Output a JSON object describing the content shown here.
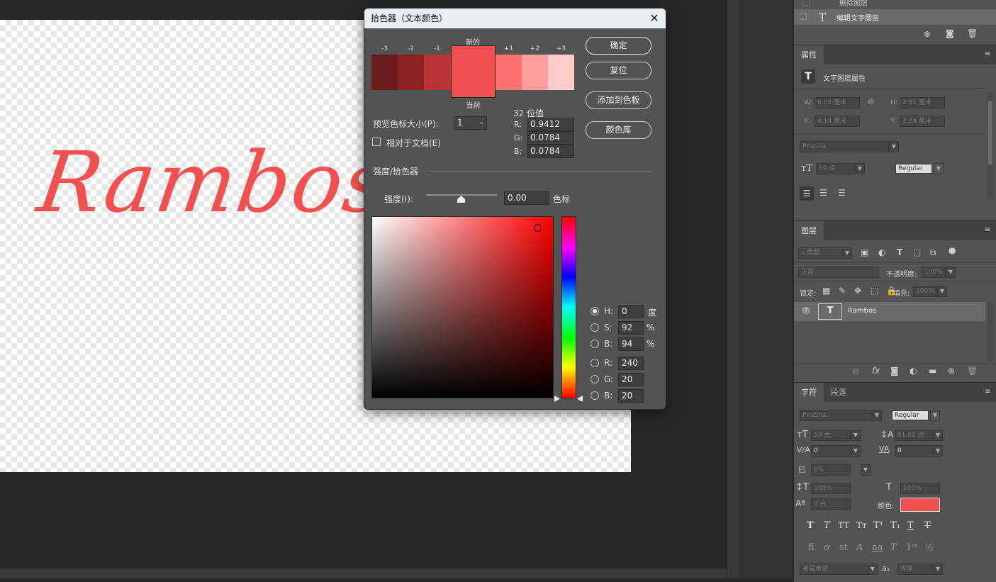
{
  "canvas": {
    "text": "Rambos",
    "text_color": "#f05050"
  },
  "layers_top": {
    "items": [
      {
        "label": "删除图层"
      },
      {
        "label": "编辑文字图层"
      }
    ]
  },
  "properties": {
    "tab": "属性",
    "kind_label": "文字图层属性",
    "w_label": "W:",
    "w_value": "6.02 厘米",
    "h_label": "H:",
    "h_value": "2.81 厘米",
    "x_label": "X:",
    "x_value": "4.14 厘米",
    "y_label": "Y:",
    "y_value": "2.24 厘米",
    "font": "Pristina",
    "size": "59 点",
    "style": "Regular"
  },
  "layers": {
    "tab": "图层",
    "filter": "类型",
    "blend": "正常",
    "opacity_label": "不透明度:",
    "opacity": "100%",
    "lock_label": "锁定:",
    "fill_label": "填充:",
    "fill": "100%",
    "layer_name": "Rambos"
  },
  "character": {
    "tab_char": "字符",
    "tab_para": "段落",
    "font": "Pristina",
    "style": "Regular",
    "size": "59 点",
    "leading": "61.01 点",
    "kerning": "0",
    "tracking": "0",
    "scale_v": "0%",
    "vscale": "105%",
    "hscale": "105%",
    "baseline": "0 点",
    "color_label": "颜色:",
    "color": "#f05050",
    "language": "美国英语",
    "aa": "浑厚"
  },
  "dialog": {
    "title": "拾色器（文本颜色）",
    "ok": "确定",
    "reset": "复位",
    "add_swatch": "添加到色板",
    "libraries": "颜色库",
    "new_label": "新的",
    "current_label": "当前",
    "steps": [
      "-3",
      "-2",
      "-1",
      "+1",
      "+2",
      "+3"
    ],
    "step_colors": [
      "#6a1c1c",
      "#8c2424",
      "#b83434",
      "#ff7070",
      "#ff9e9e",
      "#ffcccc"
    ],
    "new_color": "#f05050",
    "preview_size_label": "预览色标大小(P):",
    "preview_size": "1",
    "relative_label": "相对于文档(E)",
    "bit_label": "32 位值",
    "r32_label": "R:",
    "r32": "0.9412",
    "g32_label": "G:",
    "g32": "0.0784",
    "b32_label": "B:",
    "b32": "0.0784",
    "section": "强度/拾色器",
    "intensity_label": "强度(I):",
    "intensity": "0.00",
    "stops_label": "色标",
    "h_label": "H:",
    "h": "0",
    "h_unit": "度",
    "s_label": "S:",
    "s": "92",
    "s_unit": "%",
    "b_label": "B:",
    "b": "94",
    "b_unit": "%",
    "r_label": "R:",
    "r": "240",
    "g_label": "G:",
    "g": "20",
    "bb_label": "B:",
    "bb": "20"
  }
}
